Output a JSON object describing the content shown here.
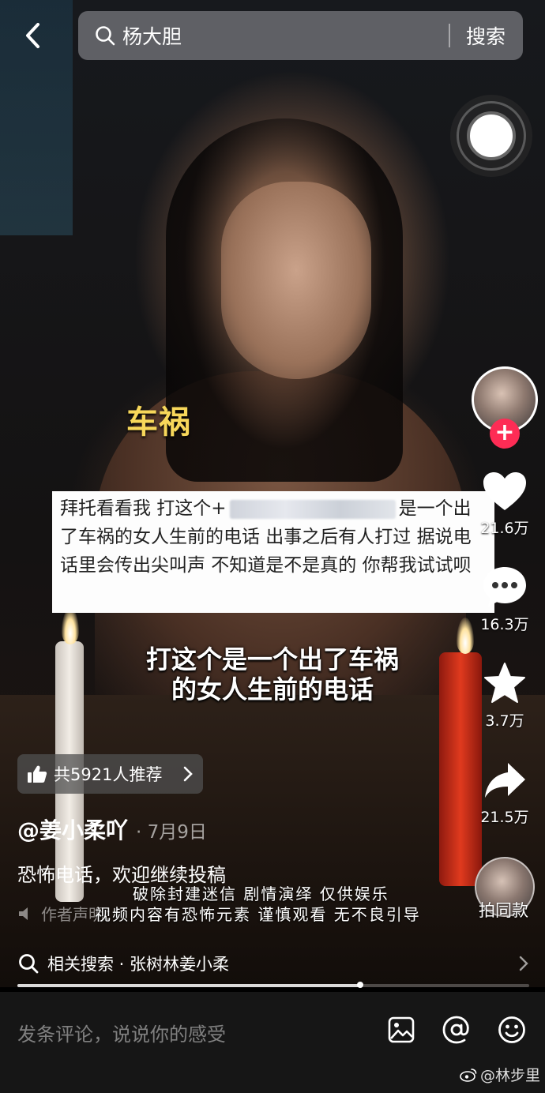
{
  "search": {
    "query": "杨大胆",
    "submit_label": "搜索"
  },
  "video": {
    "caption_yellow": "车祸",
    "message_part1": "拜托看看我 打这个+",
    "message_part2": "是一个出了车祸的女人生前的电话 出事之后有人打过 据说电话里会传出尖叫声 不知道是不是真的 你帮我试试呗",
    "subtitle_line1": "打这个是一个出了车祸",
    "subtitle_line2": "的女人生前的电话",
    "overlay_line1": "破除封建迷信 剧情演绎 仅供娱乐",
    "overlay_line2": "视频内容有恐怖元素 谨慎观看 无不良引导"
  },
  "actions": {
    "likes": "21.6万",
    "comments": "16.3万",
    "favorites": "3.7万",
    "shares": "21.5万",
    "remix_label": "拍同款"
  },
  "info": {
    "recommend": "共5921人推荐",
    "author": "@姜小柔吖",
    "date": "· 7月9日",
    "description": "恐怖电话，欢迎继续投稿",
    "disclaimer": "作者声明：",
    "related": "相关搜索 · 张树林姜小柔",
    "progress": 0.67
  },
  "comment": {
    "placeholder": "发条评论，说说你的感受"
  },
  "watermark": "@林步里",
  "colors": {
    "accent": "#fe2c55",
    "caption": "#f7d75a"
  }
}
